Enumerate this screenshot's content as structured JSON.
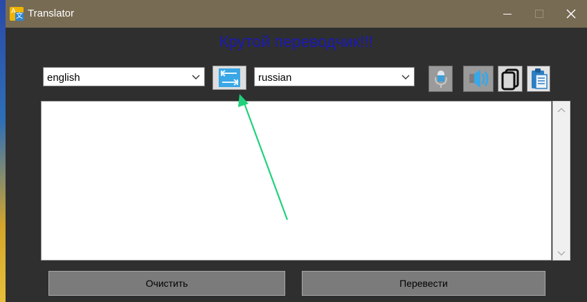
{
  "window": {
    "title": "Translator",
    "icon": "translator-app-icon"
  },
  "heading": "Крутой переводчик!!!",
  "source_language": {
    "selected": "english",
    "icon": "chevron-down-icon"
  },
  "target_language": {
    "selected": "russian",
    "icon": "chevron-down-icon"
  },
  "toolbar": {
    "swap_icon": "swap-languages-icon",
    "mic_icon": "microphone-icon",
    "speaker_icon": "speaker-icon",
    "copy_icon": "copy-icon",
    "paste_icon": "paste-clipboard-icon"
  },
  "input_text": "",
  "buttons": {
    "clear_label": "Очистить",
    "translate_label": "Перевести"
  },
  "colors": {
    "titlebar": "#776b53",
    "window_bg": "#2f2f2f",
    "heading": "#1a1ab4",
    "annotation_arrow": "#1fd17a"
  }
}
